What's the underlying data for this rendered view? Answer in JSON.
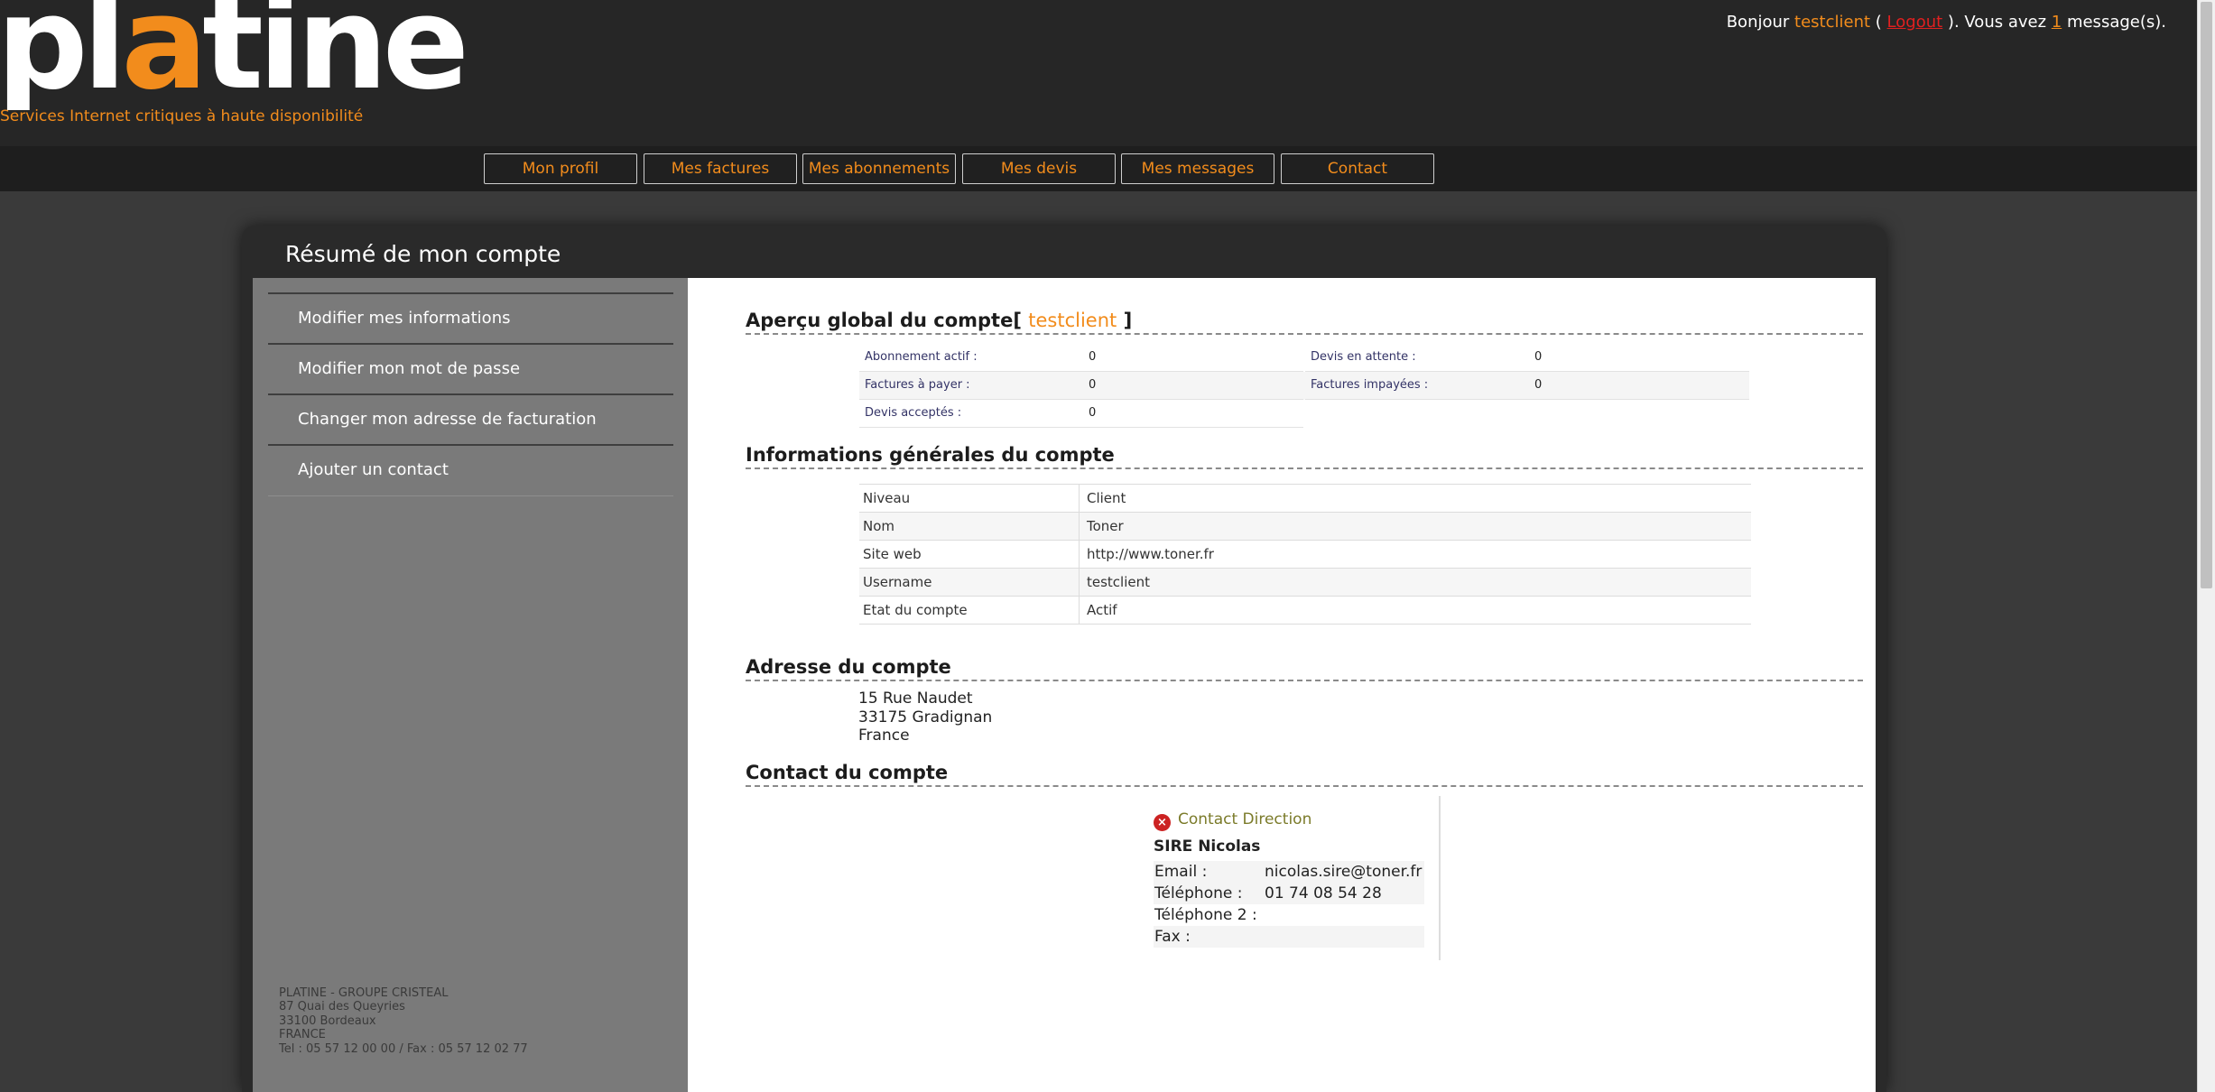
{
  "header": {
    "logo": "platine",
    "tagline": "Services Internet critiques à haute disponibilité",
    "greeting": "Bonjour",
    "username": "testclient",
    "logout_open": "(",
    "logout_label": "Logout",
    "logout_close": "). Vous avez",
    "message_count": "1",
    "message_suffix": "message(s)."
  },
  "nav": [
    {
      "label": "Mon profil"
    },
    {
      "label": "Mes factures"
    },
    {
      "label": "Mes abonnements"
    },
    {
      "label": "Mes devis"
    },
    {
      "label": "Mes messages"
    },
    {
      "label": "Contact"
    }
  ],
  "panel": {
    "title": "Résumé de mon compte"
  },
  "sidebar": {
    "items": [
      {
        "label": "Modifier mes informations"
      },
      {
        "label": "Modifier mon mot de passe"
      },
      {
        "label": "Changer mon adresse de facturation"
      },
      {
        "label": "Ajouter un contact"
      }
    ],
    "footer": [
      "PLATINE - GROUPE CRISTEAL",
      "87 Quai des Queyries",
      "33100 Bordeaux",
      "FRANCE",
      "Tel : 05 57 12 00 00 / Fax : 05 57 12 02 77"
    ]
  },
  "overview": {
    "title": "Aperçu global du compte[",
    "username": "testclient",
    "title_close": "]",
    "rows": [
      {
        "label": "Abonnement actif :",
        "value": "0",
        "label2": "Devis en attente :",
        "value2": "0"
      },
      {
        "label": "Factures à payer :",
        "value": "0",
        "label2": "Factures impayées :",
        "value2": "0"
      },
      {
        "label": "Devis acceptés :",
        "value": "0"
      }
    ]
  },
  "general": {
    "title": "Informations générales du compte",
    "rows": [
      {
        "key": "Niveau",
        "value": "Client"
      },
      {
        "key": "Nom",
        "value": "Toner"
      },
      {
        "key": "Site web",
        "value": "http://www.toner.fr"
      },
      {
        "key": "Username",
        "value": "testclient"
      },
      {
        "key": "Etat du compte",
        "value": "Actif"
      }
    ]
  },
  "address": {
    "title": "Adresse du compte",
    "lines": [
      "15 Rue Naudet",
      "33175 Gradignan",
      "France"
    ]
  },
  "contact": {
    "title": "Contact du compte",
    "type": "Contact Direction",
    "name": "SIRE Nicolas",
    "rows": [
      {
        "key": "Email :",
        "value": "nicolas.sire@toner.fr"
      },
      {
        "key": "Téléphone :",
        "value": "01 74 08 54 28"
      },
      {
        "key": "Téléphone 2 :",
        "value": ""
      },
      {
        "key": "Fax :",
        "value": ""
      }
    ]
  },
  "colors": {
    "accent": "#f28c1c",
    "header_bg": "#262626",
    "sidebar_bg": "#7a7a7a",
    "link_red": "#e02020"
  }
}
